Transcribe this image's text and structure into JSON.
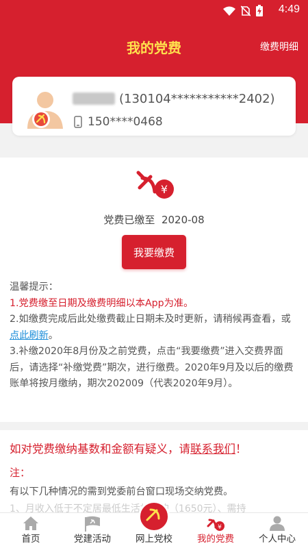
{
  "status_bar": {
    "time": "4:49"
  },
  "header": {
    "title": "我的党费",
    "detail_link": "缴费明细"
  },
  "user": {
    "name_masked": "(130104***********2402)",
    "phone_masked": "150****0468"
  },
  "dues": {
    "paid_until_label": "党费已缴至",
    "paid_until_value": "2020-08",
    "pay_button": "我要缴费"
  },
  "tips": {
    "title": "温馨提示：",
    "item1": "1.党费缴至日期及缴费明细以本App为准。",
    "item2_before": "2.如缴费完成后此处缴费截止日期未及时更新，请稍候再查看，或",
    "item2_link": "点此刷新",
    "item2_after": "。",
    "item3": "3.补缴2020年8月份及之前党费，点击“我要缴费”进入交费界面后，请选择“补缴党费”期次，进行缴费。2020年9月及以后的缴费账单将按月缴纳，期次202009（代表2020年9月）。"
  },
  "notice": {
    "title_before": "如对党费缴纳基数和金额有疑义，请",
    "title_link": "联系我们",
    "title_after": "！",
    "note_label": "注：",
    "note_text": "有以下几种情况的需到党委前台窗口现场交纳党费。",
    "note_partial": "1、月收入低于不定居最低生活标准的（1650元）、需持"
  },
  "tabs": [
    {
      "label": "首页",
      "icon": "home-icon"
    },
    {
      "label": "党建活动",
      "icon": "flag-icon"
    },
    {
      "label": "网上党校",
      "icon": "party-emblem-icon"
    },
    {
      "label": "我的党费",
      "icon": "party-dues-icon"
    },
    {
      "label": "个人中心",
      "icon": "person-icon"
    }
  ],
  "colors": {
    "primary": "#d6202e",
    "title_yellow": "#ffe14d",
    "link_blue": "#1a8cd8"
  }
}
